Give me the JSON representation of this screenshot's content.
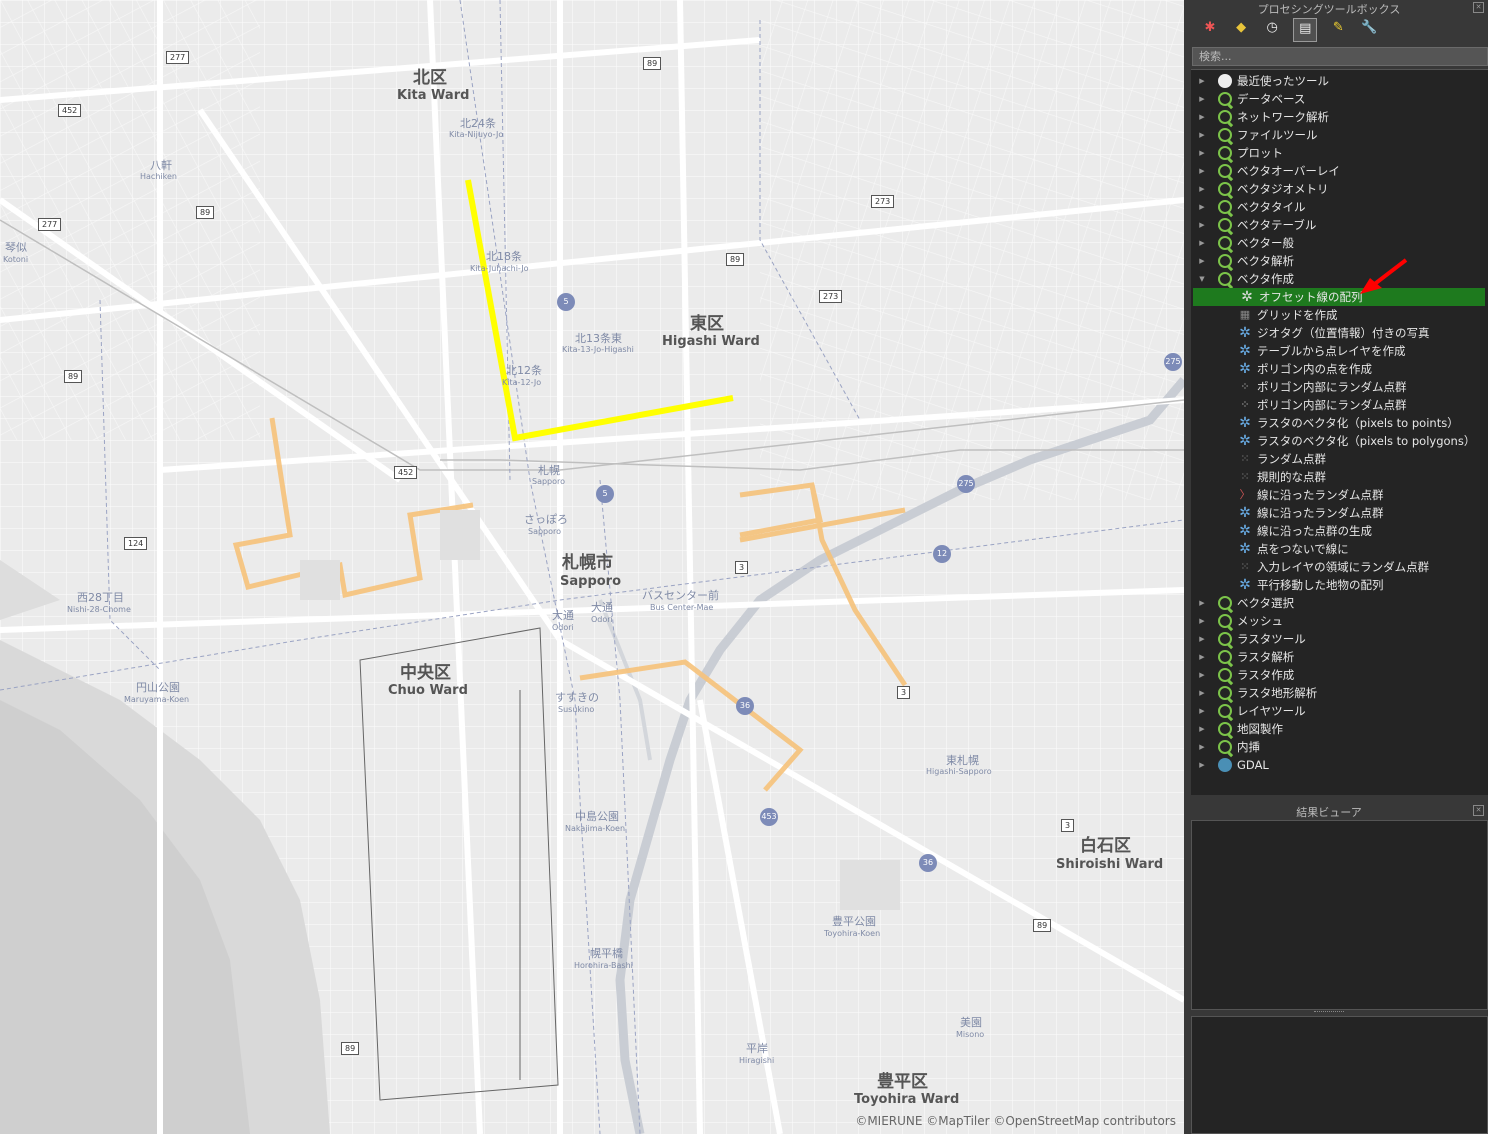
{
  "map": {
    "wards": [
      {
        "jp": "北区",
        "en": "Kita Ward"
      },
      {
        "jp": "東区",
        "en": "Higashi Ward"
      },
      {
        "jp": "札幌市",
        "en": "Sapporo"
      },
      {
        "jp": "中央区",
        "en": "Chuo Ward"
      },
      {
        "jp": "白石区",
        "en": "Shiroishi Ward"
      },
      {
        "jp": "豊平区",
        "en": "Toyohira Ward"
      }
    ],
    "stations": [
      {
        "jp": "北24条",
        "en": "Kita-Nijuyo-Jo"
      },
      {
        "jp": "北18条",
        "en": "Kita-Juhachi-Jo"
      },
      {
        "jp": "北13条東",
        "en": "Kita-13-Jo-Higashi"
      },
      {
        "jp": "北12条",
        "en": "Kita-12-Jo"
      },
      {
        "jp": "札幌",
        "en": "Sapporo"
      },
      {
        "jp": "さっぽろ",
        "en": "Sapporo"
      },
      {
        "jp": "八軒",
        "en": "Hachiken"
      },
      {
        "jp": "琴似",
        "en": "Kotoni"
      },
      {
        "jp": "西28丁目",
        "en": "Nishi-28-Chome"
      },
      {
        "jp": "円山公園",
        "en": "Maruyama-Koen"
      },
      {
        "jp": "大通",
        "en": "Odori"
      },
      {
        "jp": "大通",
        "en": "Odori"
      },
      {
        "jp": "バスセンター前",
        "en": "Bus Center-Mae"
      },
      {
        "jp": "すすきの",
        "en": "Susukino"
      },
      {
        "jp": "中島公園",
        "en": "Nakajima-Koen"
      },
      {
        "jp": "幌平橋",
        "en": "Horohira-Bashi"
      },
      {
        "jp": "平岸",
        "en": "Hiragishi"
      },
      {
        "jp": "美園",
        "en": "Misono"
      },
      {
        "jp": "豊平公園",
        "en": "Toyohira-Koen"
      },
      {
        "jp": "東札幌",
        "en": "Higashi-Sapporo"
      }
    ],
    "routes": [
      "277",
      "452",
      "89",
      "277",
      "89",
      "89",
      "124",
      "452",
      "5",
      "5",
      "89",
      "273",
      "273",
      "3",
      "3",
      "3",
      "89",
      "89",
      "275",
      "275",
      "12",
      "36",
      "36",
      "453"
    ],
    "attribution": "©MIERUNE ©MapTiler ©OpenStreetMap contributors"
  },
  "colors": {
    "yellow_line": "#ffff00",
    "orange_line": "#f6c27a",
    "selected": "#1e7a1e",
    "annotation": "#ff0000"
  },
  "panel": {
    "title": "プロセシングツールボックス",
    "search_placeholder": "検索...",
    "toolbar_icons": [
      "models-icon",
      "python-icon",
      "history-icon",
      "results-icon",
      "edit-icon",
      "options-icon"
    ],
    "tree": [
      {
        "label": "最近使ったツール",
        "icon": "clock",
        "expand": "collapsed"
      },
      {
        "label": "データベース",
        "icon": "qgis",
        "expand": "collapsed"
      },
      {
        "label": "ネットワーク解析",
        "icon": "qgis",
        "expand": "collapsed"
      },
      {
        "label": "ファイルツール",
        "icon": "qgis",
        "expand": "collapsed"
      },
      {
        "label": "プロット",
        "icon": "qgis",
        "expand": "collapsed"
      },
      {
        "label": "ベクタオーバーレイ",
        "icon": "qgis",
        "expand": "collapsed"
      },
      {
        "label": "ベクタジオメトリ",
        "icon": "qgis",
        "expand": "collapsed"
      },
      {
        "label": "ベクタタイル",
        "icon": "qgis",
        "expand": "collapsed"
      },
      {
        "label": "ベクタテーブル",
        "icon": "qgis",
        "expand": "collapsed"
      },
      {
        "label": "ベクター般",
        "icon": "qgis",
        "expand": "collapsed"
      },
      {
        "label": "ベクタ解析",
        "icon": "qgis",
        "expand": "collapsed"
      },
      {
        "label": "ベクタ作成",
        "icon": "qgis",
        "expand": "expanded"
      },
      {
        "label": "オフセット線の配列",
        "icon": "gear-white",
        "child": true,
        "selected": true
      },
      {
        "label": "グリッドを作成",
        "icon": "grid",
        "child": true
      },
      {
        "label": "ジオタグ（位置情報）付きの写真",
        "icon": "gear",
        "child": true
      },
      {
        "label": "テーブルから点レイヤを作成",
        "icon": "gear",
        "child": true
      },
      {
        "label": "ポリゴン内の点を作成",
        "icon": "gear",
        "child": true
      },
      {
        "label": "ポリゴン内部にランダム点群",
        "icon": "dots",
        "child": true
      },
      {
        "label": "ポリゴン内部にランダム点群",
        "icon": "dots",
        "child": true
      },
      {
        "label": "ラスタのベクタ化（pixels to points）",
        "icon": "gear",
        "child": true
      },
      {
        "label": "ラスタのベクタ化（pixels to polygons）",
        "icon": "gear",
        "child": true
      },
      {
        "label": "ランダム点群",
        "icon": "scatter",
        "child": true
      },
      {
        "label": "規則的な点群",
        "icon": "scatter",
        "child": true
      },
      {
        "label": "線に沿ったランダム点群",
        "icon": "line-dots",
        "child": true
      },
      {
        "label": "線に沿ったランダム点群",
        "icon": "gear",
        "child": true
      },
      {
        "label": "線に沿った点群の生成",
        "icon": "gear",
        "child": true
      },
      {
        "label": "点をつないで線に",
        "icon": "gear",
        "child": true
      },
      {
        "label": "入力レイヤの領域にランダム点群",
        "icon": "scatter",
        "child": true
      },
      {
        "label": "平行移動した地物の配列",
        "icon": "gear",
        "child": true
      },
      {
        "label": "ベクタ選択",
        "icon": "qgis",
        "expand": "collapsed"
      },
      {
        "label": "メッシュ",
        "icon": "qgis",
        "expand": "collapsed"
      },
      {
        "label": "ラスタツール",
        "icon": "qgis",
        "expand": "collapsed"
      },
      {
        "label": "ラスタ解析",
        "icon": "qgis",
        "expand": "collapsed"
      },
      {
        "label": "ラスタ作成",
        "icon": "qgis",
        "expand": "collapsed"
      },
      {
        "label": "ラスタ地形解析",
        "icon": "qgis",
        "expand": "collapsed"
      },
      {
        "label": "レイヤツール",
        "icon": "qgis",
        "expand": "collapsed"
      },
      {
        "label": "地図製作",
        "icon": "qgis",
        "expand": "collapsed"
      },
      {
        "label": "内挿",
        "icon": "qgis",
        "expand": "collapsed"
      },
      {
        "label": "GDAL",
        "icon": "gdal",
        "expand": "collapsed"
      }
    ],
    "results_title": "結果ビューア"
  }
}
